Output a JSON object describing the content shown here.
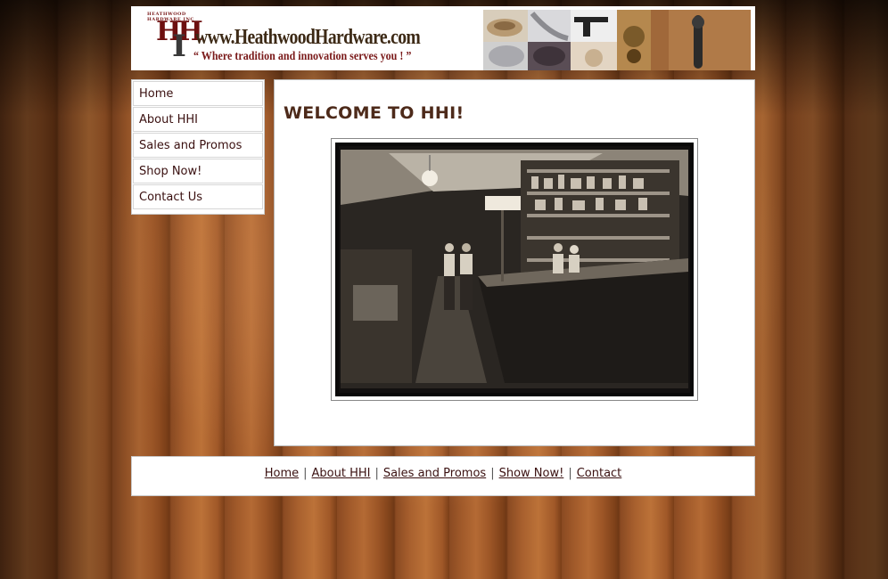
{
  "header": {
    "logo_ring_text": "HEATHWOOD HARDWARE INC",
    "logo_letters": "HH",
    "logo_letter_i": "I",
    "site_url": "www.HeathwoodHardware.com",
    "tagline": "“ Where tradition and innovation serves you ! ”"
  },
  "sidebar": {
    "items": [
      {
        "label": "Home"
      },
      {
        "label": "About HHI"
      },
      {
        "label": "Sales and Promos"
      },
      {
        "label": "Shop Now!"
      },
      {
        "label": "Contact Us"
      }
    ]
  },
  "main": {
    "title": "WELCOME TO HHI!"
  },
  "footer": {
    "links": [
      {
        "label": "Home"
      },
      {
        "label": "About HHI"
      },
      {
        "label": "Sales and Promos"
      },
      {
        "label": "Show Now!"
      },
      {
        "label": "Contact"
      }
    ],
    "separator": "|"
  },
  "colors": {
    "nav_text": "#3a1010",
    "title": "#4d2a1a",
    "wood": "#8a4a22"
  }
}
